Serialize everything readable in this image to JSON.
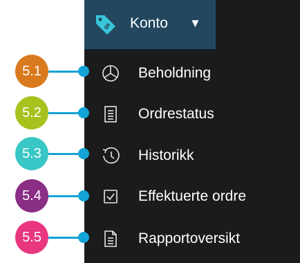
{
  "header": {
    "label": "Konto",
    "caret": "▼",
    "icon": "tag-dollar-icon"
  },
  "menu": {
    "items": [
      {
        "label": "Beholdning",
        "icon": "pie-chart-icon"
      },
      {
        "label": "Ordrestatus",
        "icon": "document-list-icon"
      },
      {
        "label": "Historikk",
        "icon": "history-clock-icon"
      },
      {
        "label": "Effektuerte ordre",
        "icon": "checkbox-checked-icon"
      },
      {
        "label": "Rapportoversikt",
        "icon": "report-document-icon"
      }
    ]
  },
  "callouts": [
    {
      "label": "5.1",
      "color": "#d97a1e"
    },
    {
      "label": "5.2",
      "color": "#a5c21d"
    },
    {
      "label": "5.3",
      "color": "#38c6c6"
    },
    {
      "label": "5.4",
      "color": "#8a2e86"
    },
    {
      "label": "5.5",
      "color": "#e9377f"
    }
  ],
  "colors": {
    "header_bg": "#22475e",
    "menu_bg": "#1b1b1b",
    "connector": "#14a3d6",
    "tag_icon": "#38c6d8"
  }
}
